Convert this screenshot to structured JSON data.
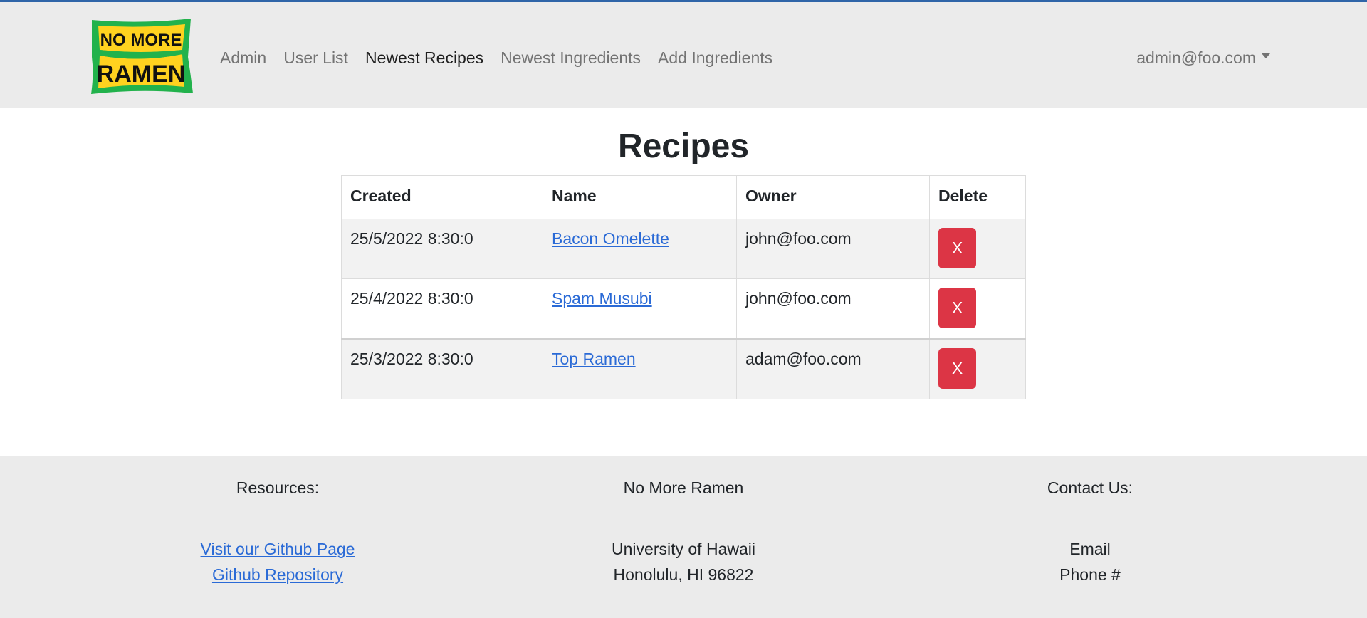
{
  "logo": {
    "line1": "NO MORE",
    "line2": "RAMEN",
    "colors": {
      "green": "#22b24c",
      "yellow": "#ffd21f",
      "ink": "#111111"
    }
  },
  "nav": {
    "links": [
      {
        "label": "Admin",
        "active": false
      },
      {
        "label": "User List",
        "active": false
      },
      {
        "label": "Newest Recipes",
        "active": true
      },
      {
        "label": "Newest Ingredients",
        "active": false
      },
      {
        "label": "Add Ingredients",
        "active": false
      }
    ],
    "user": "admin@foo.com"
  },
  "page": {
    "title": "Recipes"
  },
  "table": {
    "headers": [
      "Created",
      "Name",
      "Owner",
      "Delete"
    ],
    "rows": [
      {
        "created": "25/5/2022 8:30:0",
        "name": "Bacon Omelette",
        "owner": "john@foo.com",
        "delete_label": "X"
      },
      {
        "created": "25/4/2022 8:30:0",
        "name": "Spam Musubi",
        "owner": "john@foo.com",
        "delete_label": "X"
      },
      {
        "created": "25/3/2022 8:30:0",
        "name": "Top Ramen",
        "owner": "adam@foo.com",
        "delete_label": "X"
      }
    ]
  },
  "footer": {
    "resources": {
      "title": "Resources:",
      "links": [
        "Visit our Github Page",
        "Github Repository"
      ]
    },
    "about": {
      "title": "No More Ramen",
      "lines": [
        "University of Hawaii",
        "Honolulu, HI 96822"
      ]
    },
    "contact": {
      "title": "Contact Us:",
      "lines": [
        "Email",
        "Phone #"
      ]
    }
  },
  "colors": {
    "accent": "#2f65a8",
    "danger": "#dc3545",
    "link": "#2a6ad6",
    "navbar_bg": "#ebebeb"
  }
}
